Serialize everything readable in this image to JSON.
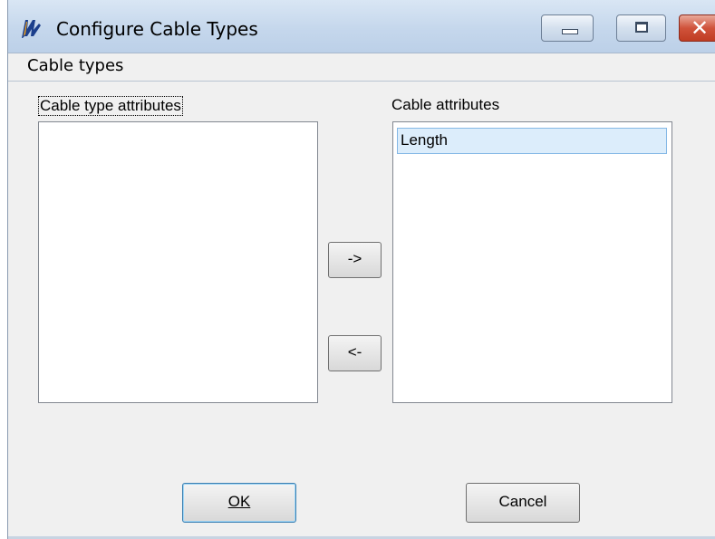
{
  "window": {
    "title": "Configure Cable Types",
    "icon": "app-logo-icon",
    "controls": [
      "minimize-icon",
      "maximize-icon",
      "close-icon"
    ]
  },
  "menu": {
    "items": [
      {
        "label": "Cable types"
      }
    ]
  },
  "left_panel": {
    "label": "Cable type attributes",
    "items": []
  },
  "right_panel": {
    "label": "Cable attributes",
    "items": [
      {
        "label": "Length",
        "selected": true
      }
    ]
  },
  "transfer": {
    "add_label": "->",
    "remove_label": "<-"
  },
  "footer": {
    "ok_label": "OK",
    "cancel_label": "Cancel"
  },
  "colors": {
    "title_bar": "#c5d7ec",
    "close_button": "#c8452c",
    "selection": "#dcedfb"
  }
}
